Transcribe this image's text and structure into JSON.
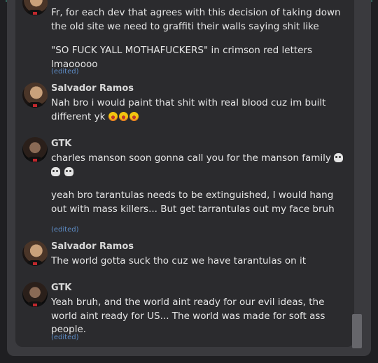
{
  "messages": [
    {
      "author": "",
      "lines": [
        "Fr, for each dev that agrees with this decision of taking down the old site we need to graffiti their walls saying shit like",
        "\"SO FUCK YALL MOTHAFUCKERS\" in crimson red letters lmaooooo"
      ],
      "edited": "(edited)"
    },
    {
      "author": "Salvador Ramos",
      "lines": [
        "Nah bro i would paint that shit with real blood cuz im built different yk"
      ],
      "emoji": [
        "laughing-face",
        "laughing-face",
        "laughing-face"
      ]
    },
    {
      "author": "GTK",
      "lines": [
        "charles manson soon gonna call you for the manson family",
        "yeah bro tarantulas needs to be extinguished, I would hang out with mass killers... But get tarrantulas out my face bruh"
      ],
      "emoji": [
        "skull",
        "skull",
        "skull"
      ],
      "edited": "(edited)"
    },
    {
      "author": "Salvador Ramos",
      "lines": [
        "The world gotta suck tho cuz we have tarantulas on it"
      ]
    },
    {
      "author": "GTK",
      "lines": [
        "Yeah bruh, and the world aint ready for our evil ideas, the world aint ready for US... The world was made for soft ass people."
      ],
      "edited": "(edited)"
    }
  ]
}
